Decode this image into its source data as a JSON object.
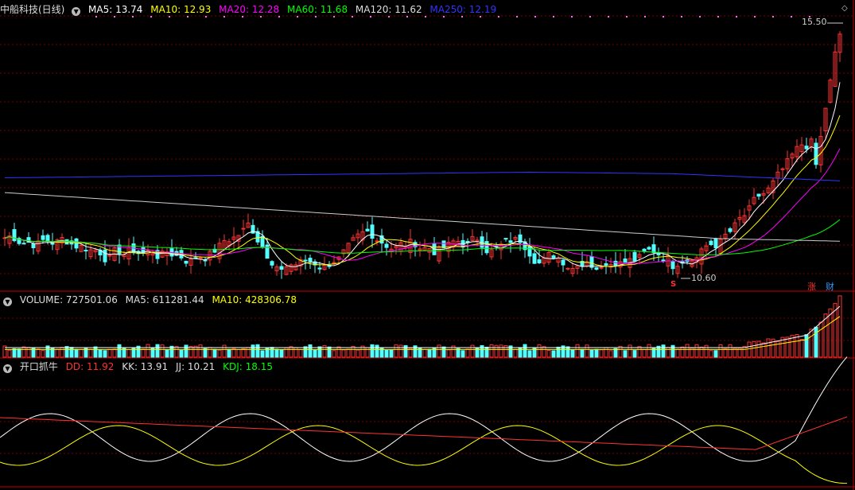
{
  "main": {
    "title": "中船科技(日线)",
    "ma": [
      {
        "label": "MA5: 13.74",
        "color": "#ffffff"
      },
      {
        "label": "MA10: 12.93",
        "color": "#ffff00"
      },
      {
        "label": "MA20: 12.28",
        "color": "#ff00ff"
      },
      {
        "label": "MA60: 11.68",
        "color": "#00ff00"
      },
      {
        "label": "MA120: 11.62",
        "color": "#dddddd"
      },
      {
        "label": "MA250: 12.19",
        "color": "#3333ff"
      }
    ],
    "high_label": "15.50",
    "low_label": "10.60",
    "badge_zhang": "涨",
    "badge_cai": "财",
    "marker_s": "S"
  },
  "volume": {
    "label": "VOLUME: 727501.06",
    "ma5": "MA5: 611281.44",
    "ma10": "MA10: 428306.78"
  },
  "indicator": {
    "name": "开口抓牛",
    "dd": "DD: 11.92",
    "kk": "KK: 13.91",
    "jj": "JJ: 10.21",
    "kdj": "KDJ: 18.15"
  },
  "colors": {
    "up": "#ff3232",
    "down": "#54ffff",
    "grid": "#800000",
    "separator": "#c00000"
  }
}
